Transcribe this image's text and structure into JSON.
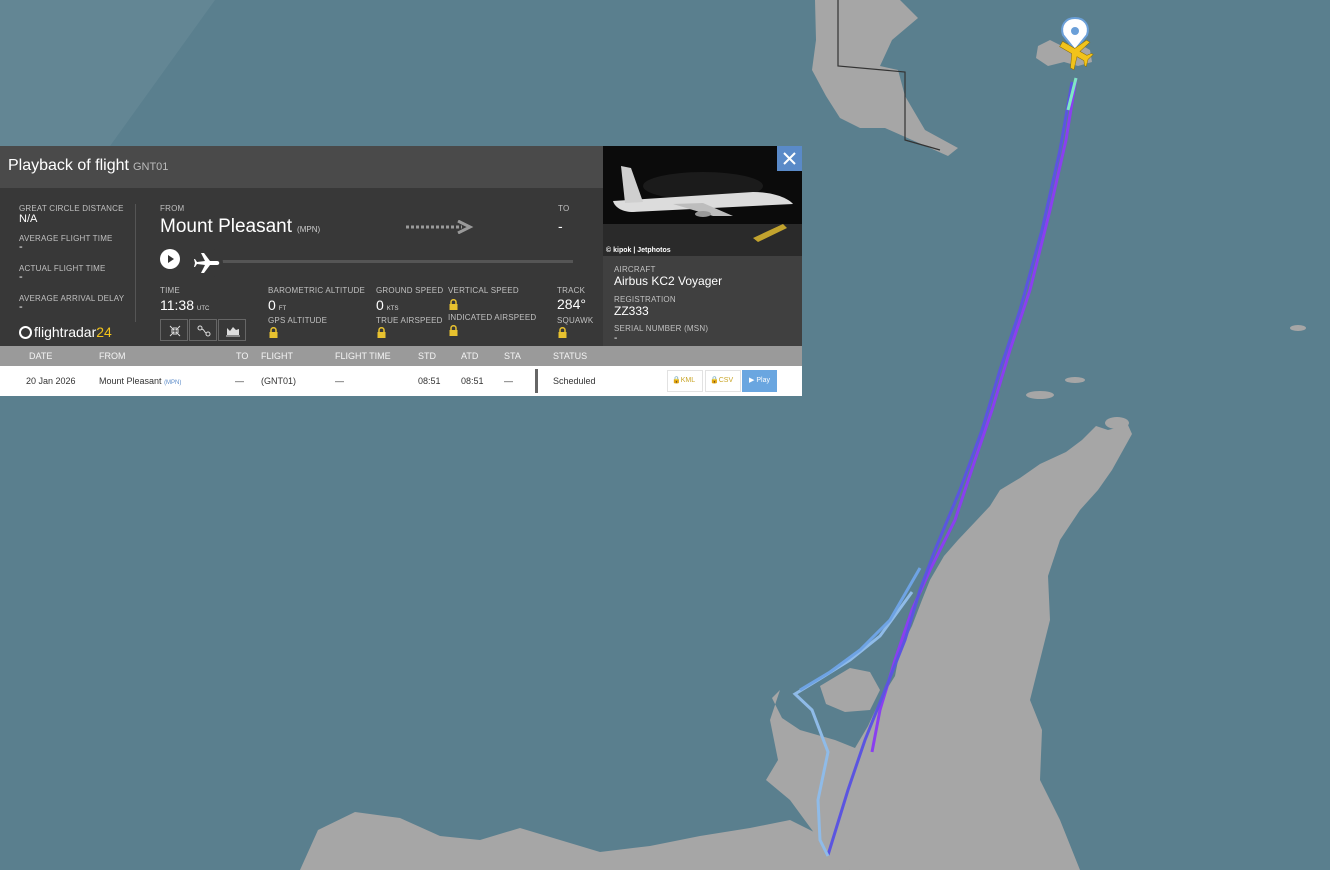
{
  "panel": {
    "title": "Playback of flight",
    "flight_code": "GNT01",
    "great_circle_distance_label": "GREAT CIRCLE DISTANCE",
    "great_circle_distance_value": "N/A",
    "average_flight_time_label": "AVERAGE FLIGHT TIME",
    "average_flight_time_value": "-",
    "actual_flight_time_label": "ACTUAL FLIGHT TIME",
    "actual_flight_time_value": "-",
    "average_arrival_delay_label": "AVERAGE ARRIVAL DELAY",
    "average_arrival_delay_value": "-",
    "brand_name_main": "flightradar",
    "brand_name_suffix": "24",
    "from_label": "FROM",
    "from_name": "Mount Pleasant",
    "from_code": "(MPN)",
    "to_label": "TO",
    "to_value": "-",
    "time_label": "TIME",
    "time_value": "11:38",
    "time_unit": "UTC",
    "baro_alt_label": "BAROMETRIC ALTITUDE",
    "baro_alt_value": "0",
    "baro_alt_unit": "FT",
    "gps_alt_label": "GPS ALTITUDE",
    "ground_speed_label": "GROUND SPEED",
    "ground_speed_value": "0",
    "ground_speed_unit": "KTS",
    "true_airspeed_label": "TRUE AIRSPEED",
    "vertical_speed_label": "VERTICAL SPEED",
    "indicated_airspeed_label": "INDICATED AIRSPEED",
    "track_label": "TRACK",
    "track_value": "284°",
    "squawk_label": "SQUAWK",
    "playback_progress": 0.0
  },
  "aircraft": {
    "photo_credit": "© kipok | Jetphotos",
    "aircraft_label": "AIRCRAFT",
    "aircraft_value": "Airbus KC2 Voyager",
    "registration_label": "REGISTRATION",
    "registration_value": "ZZ333",
    "serial_label": "SERIAL NUMBER (MSN)",
    "serial_value": "-"
  },
  "table": {
    "headers": {
      "date": "DATE",
      "from": "FROM",
      "to": "TO",
      "flight": "FLIGHT",
      "flight_time": "FLIGHT TIME",
      "std": "STD",
      "atd": "ATD",
      "sta": "STA",
      "status": "STATUS"
    },
    "row": {
      "date": "20 Jan 2026",
      "from": "Mount Pleasant",
      "from_code": "(MPN)",
      "to": "—",
      "flight": "(GNT01)",
      "flight_time": "—",
      "std": "08:51",
      "atd": "08:51",
      "sta": "—",
      "status": "Scheduled",
      "kml_label": "KML",
      "csv_label": "CSV",
      "play_label": "Play"
    }
  },
  "colors": {
    "ocean": "#5a7f8e",
    "land": "#a6a6a6",
    "accent_blue": "#5a8ac8",
    "lock_yellow": "#e8c22f",
    "track_purple": "#8a3ff0",
    "track_light_blue": "#7fb1e6"
  },
  "icons": [
    "play-icon",
    "plane-icon",
    "arrow-right-icon",
    "lock-icon",
    "close-icon",
    "compress-icon",
    "route-icon",
    "chart-icon",
    "location-pin-icon"
  ]
}
